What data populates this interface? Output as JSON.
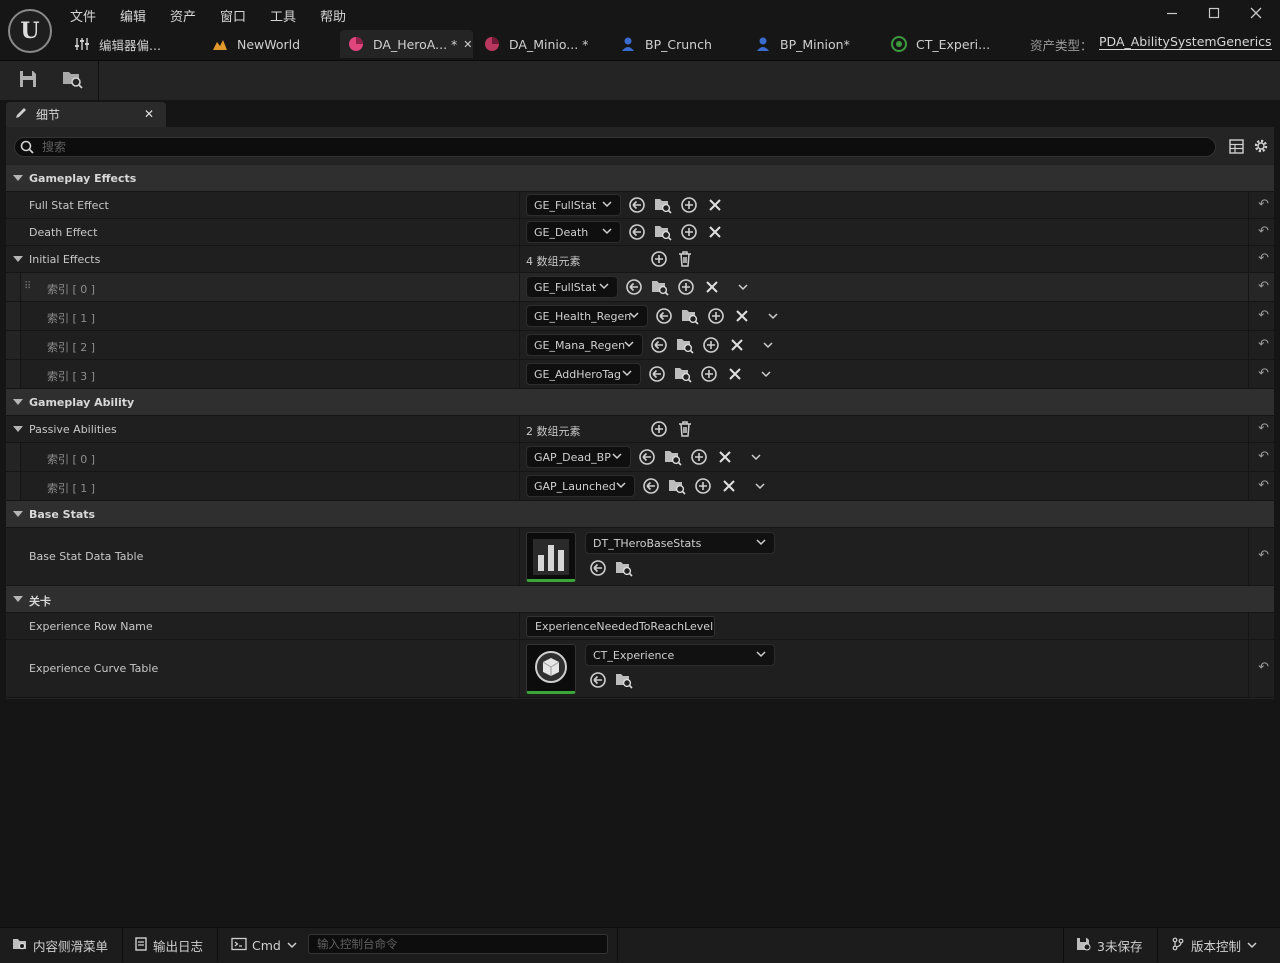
{
  "menubar": [
    "文件",
    "编辑",
    "资产",
    "窗口",
    "工具",
    "帮助"
  ],
  "tabs": [
    {
      "label": "编辑器偏...",
      "icon": "sliders-icon"
    },
    {
      "label": "NewWorld",
      "icon": "level-icon"
    },
    {
      "label": "DA_HeroA... *",
      "icon": "data-asset-icon",
      "active": true
    },
    {
      "label": "DA_Minio... *",
      "icon": "data-asset-icon"
    },
    {
      "label": "BP_Crunch",
      "icon": "blueprint-icon"
    },
    {
      "label": "BP_Minion*",
      "icon": "blueprint-icon"
    },
    {
      "label": "CT_Experi...",
      "icon": "curve-table-icon"
    }
  ],
  "asset_type": {
    "label": "资产类型：",
    "value": "PDA_AbilitySystemGenerics"
  },
  "details": {
    "tab_label": "细节",
    "search_placeholder": "搜索",
    "gameplay_effects": {
      "title": "Gameplay Effects",
      "full_stat_effect": {
        "label": "Full Stat Effect",
        "value": "GE_FullStat"
      },
      "death_effect": {
        "label": "Death Effect",
        "value": "GE_Death"
      },
      "initial_effects": {
        "label": "Initial Effects",
        "count": "4 数组元素",
        "items": [
          {
            "label": "索引 [ 0 ]",
            "value": "GE_FullStat"
          },
          {
            "label": "索引 [ 1 ]",
            "value": "GE_Health_Regen"
          },
          {
            "label": "索引 [ 2 ]",
            "value": "GE_Mana_Regen"
          },
          {
            "label": "索引 [ 3 ]",
            "value": "GE_AddHeroTag"
          }
        ]
      }
    },
    "gameplay_ability": {
      "title": "Gameplay Ability",
      "passive_abilities": {
        "label": "Passive Abilities",
        "count": "2 数组元素",
        "items": [
          {
            "label": "索引 [ 0 ]",
            "value": "GAP_Dead_BP"
          },
          {
            "label": "索引 [ 1 ]",
            "value": "GAP_Launched"
          }
        ]
      }
    },
    "base_stats": {
      "title": "Base Stats",
      "data_table": {
        "label": "Base Stat Data Table",
        "value": "DT_THeroBaseStats"
      }
    },
    "level": {
      "title": "关卡",
      "row_name": {
        "label": "Experience Row Name",
        "value": "ExperienceNeededToReachLevel"
      },
      "curve_table": {
        "label": "Experience Curve Table",
        "value": "CT_Experience"
      }
    }
  },
  "statusbar": {
    "content_drawer": "内容侧滑菜单",
    "output_log": "输出日志",
    "cmd": "Cmd",
    "cmd_placeholder": "输入控制台命令",
    "unsaved": "3未保存",
    "source_control": "版本控制"
  },
  "colors": {
    "accent_green": "#3aa63a",
    "data_asset": "#e0457b",
    "blueprint": "#3a6ccf",
    "curve_table": "#3c9a3c",
    "level": "#e09a2b"
  }
}
